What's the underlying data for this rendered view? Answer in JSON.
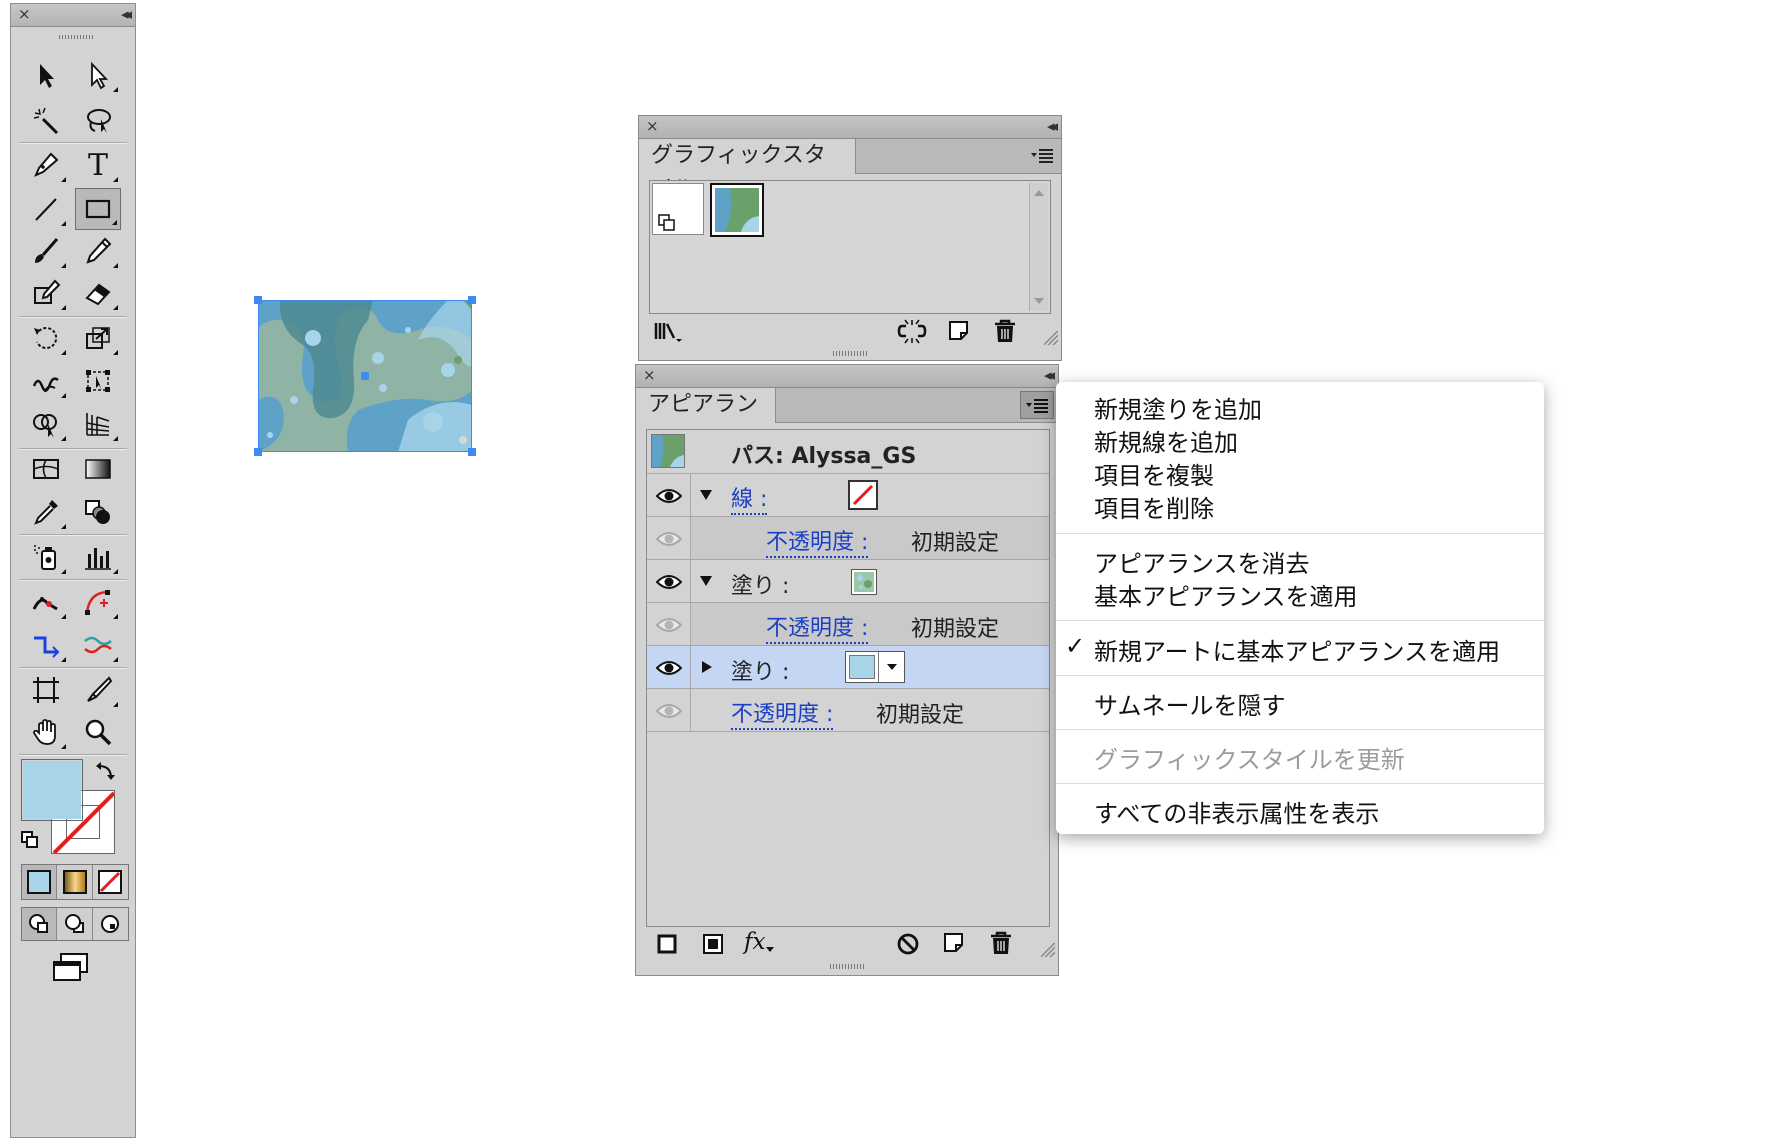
{
  "tools_panel": {
    "close_glyph": "×",
    "collapse_glyph": "◂◂",
    "tools": [
      {
        "name": "selection-tool-icon"
      },
      {
        "name": "direct-selection-tool-icon"
      },
      {
        "name": "magic-wand-tool-icon"
      },
      {
        "name": "lasso-tool-icon"
      },
      {
        "name": "pen-tool-icon"
      },
      {
        "name": "type-tool-icon",
        "glyph": "T"
      },
      {
        "name": "line-segment-tool-icon"
      },
      {
        "name": "rectangle-tool-icon"
      },
      {
        "name": "paintbrush-tool-icon"
      },
      {
        "name": "pencil-tool-icon"
      },
      {
        "name": "shaper-tool-icon"
      },
      {
        "name": "eraser-tool-icon"
      },
      {
        "name": "rotate-tool-icon"
      },
      {
        "name": "scale-tool-icon"
      },
      {
        "name": "warp-tool-icon"
      },
      {
        "name": "free-transform-tool-icon"
      },
      {
        "name": "shape-builder-tool-icon"
      },
      {
        "name": "perspective-grid-tool-icon"
      },
      {
        "name": "mesh-tool-icon"
      },
      {
        "name": "gradient-tool-icon"
      },
      {
        "name": "eyedropper-tool-icon"
      },
      {
        "name": "blend-tool-icon"
      },
      {
        "name": "symbol-sprayer-tool-icon"
      },
      {
        "name": "column-graph-tool-icon"
      },
      {
        "name": "puppet-warp-tool-icon"
      },
      {
        "name": "curvature-tool-icon"
      },
      {
        "name": "join-tool-icon"
      },
      {
        "name": "width-tool-icon"
      },
      {
        "name": "artboard-tool-icon"
      },
      {
        "name": "slice-tool-icon"
      },
      {
        "name": "hand-tool-icon"
      },
      {
        "name": "zoom-tool-icon"
      }
    ],
    "fill_color": "#a8d4ea",
    "stroke_color": "none"
  },
  "graphic_styles_panel": {
    "title": "グラフィックスタイル",
    "close_glyph": "×",
    "collapse_glyph": "◂◂"
  },
  "appearance_panel": {
    "title": "アピアランス",
    "close_glyph": "×",
    "collapse_glyph": "◂◂",
    "header": "パス: Alyssa_GS",
    "rows": [
      {
        "label": "線 :",
        "link": true
      },
      {
        "label": "不透明度 :",
        "value": "初期設定"
      },
      {
        "label": "塗り :"
      },
      {
        "label": "不透明度 :",
        "value": "初期設定"
      },
      {
        "label": "塗り :"
      },
      {
        "label": "不透明度 :",
        "value": "初期設定"
      }
    ],
    "fx_label": "fx"
  },
  "context_menu": {
    "items": [
      "新規塗りを追加",
      "新規線を追加",
      "項目を複製",
      "項目を削除",
      "アピアランスを消去",
      "基本アピアランスを適用",
      "新規アートに基本アピアランスを適用",
      "サムネールを隠す",
      "グラフィックスタイルを更新",
      "すべての非表示属性を表示"
    ],
    "check_glyph": "✓"
  },
  "colors": {
    "accent_blue": "#1a3fc6",
    "selected_row": "#c4d6f3",
    "selection_handle": "#3d8bf0"
  }
}
